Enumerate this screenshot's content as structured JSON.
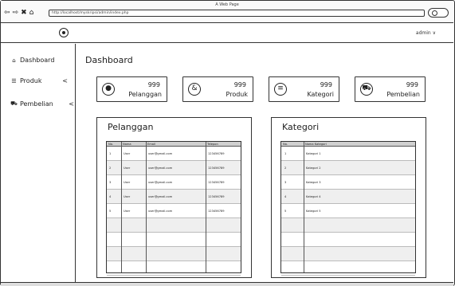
{
  "window": {
    "title": "A Web Page",
    "url": "http://localhost/myskripsi/admin/index.php"
  },
  "nav_icons": [
    "back-icon",
    "forward-icon",
    "close-icon",
    "home-icon"
  ],
  "header": {
    "user_label": "admin ∨"
  },
  "sidebar": {
    "items": [
      {
        "label": "Dashboard",
        "icon": "⌂"
      },
      {
        "label": "Produk",
        "icon": "☰",
        "chevron": "<"
      },
      {
        "label": "Pembelian",
        "icon": "⛟",
        "chevron": "<"
      }
    ]
  },
  "main": {
    "title": "Dashboard",
    "stats": [
      {
        "value": "999",
        "label": "Pelanggan",
        "icon": "user-icon",
        "glyph": "●"
      },
      {
        "value": "999",
        "label": "Produk",
        "icon": "products-icon",
        "glyph": "&"
      },
      {
        "value": "999",
        "label": "Kategori",
        "icon": "list-icon",
        "glyph": "≡"
      },
      {
        "value": "999",
        "label": "Pembelian",
        "icon": "cart-icon",
        "glyph": "⛟"
      }
    ]
  },
  "pelanggan": {
    "title": "Pelanggan",
    "columns": [
      "No.",
      "Nama",
      "Email",
      "Telepon"
    ],
    "rows": [
      [
        "1",
        "User",
        "user@gmail.com",
        "123456789"
      ],
      [
        "2",
        "User",
        "user@gmail.com",
        "123456789"
      ],
      [
        "3",
        "User",
        "user@gmail.com",
        "123456789"
      ],
      [
        "4",
        "User",
        "user@gmail.com",
        "123456789"
      ],
      [
        "5",
        "User",
        "user@gmail.com",
        "123456789"
      ],
      [
        "",
        "",
        "",
        ""
      ],
      [
        "",
        "",
        "",
        ""
      ],
      [
        "",
        "",
        "",
        ""
      ],
      [
        "",
        "",
        "",
        ""
      ]
    ]
  },
  "kategori": {
    "title": "Kategori",
    "columns": [
      "No.",
      "Nama Kategori"
    ],
    "rows": [
      [
        "1",
        "Kategori 1"
      ],
      [
        "2",
        "Kategori 2"
      ],
      [
        "3",
        "Kategori 3"
      ],
      [
        "4",
        "Kategori 4"
      ],
      [
        "5",
        "Kategori 5"
      ],
      [
        "",
        ""
      ],
      [
        "",
        ""
      ],
      [
        "",
        ""
      ],
      [
        "",
        ""
      ]
    ]
  }
}
